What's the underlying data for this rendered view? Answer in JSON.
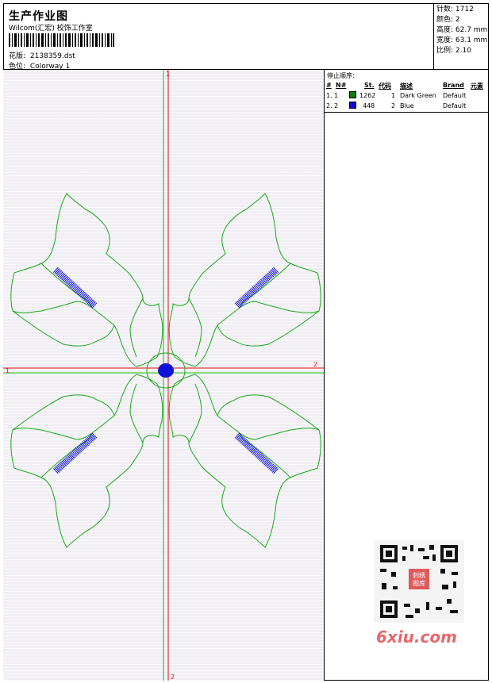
{
  "header": {
    "title": "生产作业图",
    "studio": "Wilcom(汇宏) 校饰工作室",
    "design_label": "花版:",
    "design_file": "2138359.dst",
    "color_label": "色位:",
    "colorway": "Colorway 1"
  },
  "stats": {
    "stitches": "针数: 1712",
    "colors": "颜色: 2",
    "height": "高度: 62.7 mm",
    "width": "宽度: 63.1 mm",
    "scale": "比例: 2.10"
  },
  "stop_sequence": {
    "title": "停止顺序:",
    "headers": [
      "#",
      "N#",
      "St.",
      "代码",
      "描述",
      "Brand",
      "元素"
    ],
    "rows": [
      {
        "index": "1.",
        "n": "1",
        "color": "#0f7d12",
        "stitches": "1262",
        "code": "1",
        "desc": "Dark Green",
        "brand": "Default"
      },
      {
        "index": "2.",
        "n": "2",
        "color": "#0a0ad8",
        "stitches": "448",
        "code": "2",
        "desc": "Blue",
        "brand": "Default"
      }
    ]
  },
  "axes": {
    "top_marker": "1",
    "bottom_marker": "2",
    "left_marker": "1",
    "right_marker": "2"
  },
  "watermark": {
    "qr_text": "刺绣图库",
    "brand": "6xiu.com"
  },
  "colors": {
    "outline": "#1aa81a",
    "fill": "#1010d8",
    "axis_red": "#e01010",
    "axis_green": "#10c010"
  }
}
